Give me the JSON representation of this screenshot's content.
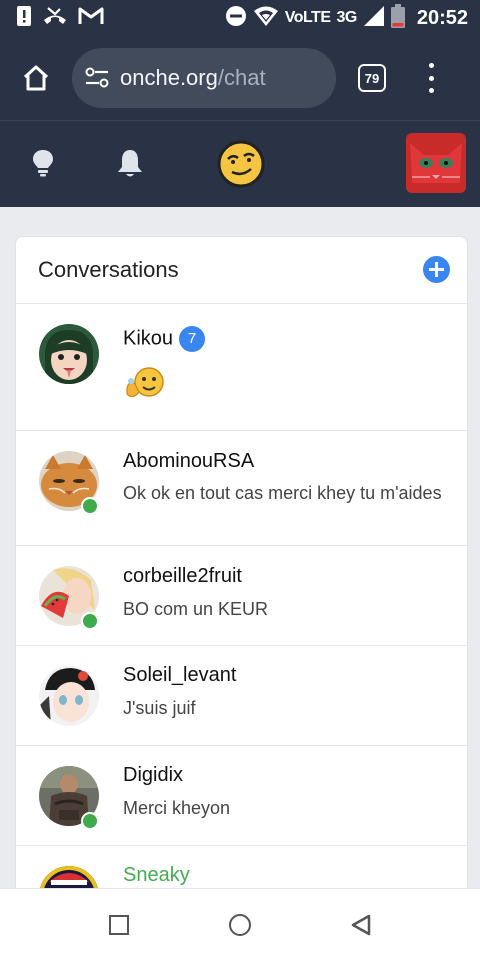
{
  "status_bar": {
    "time": "20:52",
    "network": "VoLTE",
    "signal_type": "3G",
    "icons": [
      "alert-icon",
      "missed-call-icon",
      "gmail-icon",
      "dnd-icon",
      "wifi-icon",
      "signal-icon",
      "battery-icon"
    ]
  },
  "browser": {
    "url_host": "onche.org",
    "url_path": "/chat",
    "tab_count": "79",
    "icons": [
      "home-icon",
      "site-settings-icon",
      "menu-icon"
    ]
  },
  "site_nav": {
    "icons": [
      "bulb-icon",
      "bell-icon",
      "smiley-icon",
      "profile-avatar"
    ]
  },
  "conversations": {
    "title": "Conversations",
    "items": [
      {
        "name": "Kikou",
        "badge": "7",
        "message": "",
        "online": false
      },
      {
        "name": "AbominouRSA",
        "message": "Ok ok en tout cas merci khey tu m'aides",
        "online": true
      },
      {
        "name": "corbeille2fruit",
        "message": "BO com un KEUR",
        "online": true
      },
      {
        "name": "Soleil_levant",
        "message": "J'suis juif",
        "online": false
      },
      {
        "name": "Digidix",
        "message": "Merci kheyon",
        "online": true
      },
      {
        "name": "Sneaky",
        "message": "",
        "online": false
      }
    ]
  },
  "colors": {
    "header_bg": "#2a3345",
    "accent_blue": "#3a86f0",
    "online_green": "#3fab4d",
    "name_green": "#43ac50"
  }
}
